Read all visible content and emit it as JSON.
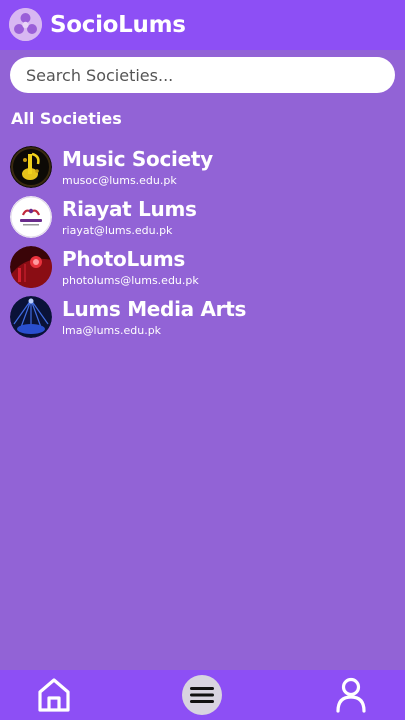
{
  "app": {
    "title": "SocioLums"
  },
  "search": {
    "placeholder": "Search Societies..."
  },
  "section": {
    "title": "All Societies"
  },
  "societies": [
    {
      "name": "Music Society",
      "email": "musoc@lums.edu.pk",
      "avatar_icon": "music-society-logo"
    },
    {
      "name": "Riayat Lums",
      "email": "riayat@lums.edu.pk",
      "avatar_icon": "riayat-logo"
    },
    {
      "name": "PhotoLums",
      "email": "photolums@lums.edu.pk",
      "avatar_icon": "photolums-logo"
    },
    {
      "name": "Lums Media Arts",
      "email": "lma@lums.edu.pk",
      "avatar_icon": "lma-logo"
    }
  ],
  "nav": {
    "home_icon": "home-icon",
    "menu_icon": "menu-icon",
    "profile_icon": "user-icon"
  },
  "colors": {
    "background": "#9263d6",
    "bars": "#8d4ff5",
    "text": "#ffffff"
  }
}
